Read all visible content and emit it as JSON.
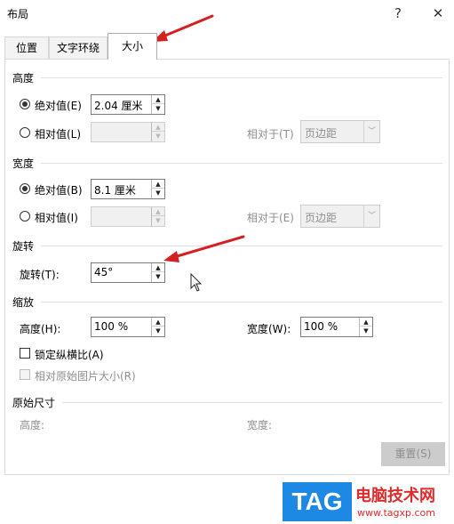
{
  "window": {
    "title": "布局",
    "help_icon": "?",
    "close_icon": "✕"
  },
  "tabs": [
    {
      "label": "位置",
      "active": false
    },
    {
      "label": "文字环绕",
      "active": false
    },
    {
      "label": "大小",
      "active": true
    }
  ],
  "height": {
    "section": "高度",
    "absolute_label": "绝对值(E)",
    "absolute_value": "2.04 厘米",
    "relative_label": "相对值(L)",
    "relative_value": "",
    "relative_to_label": "相对于(T)",
    "relative_to_value": "页边距"
  },
  "width": {
    "section": "宽度",
    "absolute_label": "绝对值(B)",
    "absolute_value": "8.1 厘米",
    "relative_label": "相对值(I)",
    "relative_value": "",
    "relative_to_label": "相对于(E)",
    "relative_to_value": "页边距"
  },
  "rotation": {
    "section": "旋转",
    "label": "旋转(T):",
    "value": "45°"
  },
  "scale": {
    "section": "缩放",
    "height_label": "高度(H):",
    "height_value": "100 %",
    "width_label": "宽度(W):",
    "width_value": "100 %",
    "lock_aspect_label": "锁定纵横比(A)",
    "lock_aspect_checked": false,
    "relative_original_label": "相对原始图片大小(R)",
    "relative_original_checked": false
  },
  "original_size": {
    "section": "原始尺寸",
    "height_label": "高度:",
    "width_label": "宽度:",
    "reset_label": "重置(S)"
  },
  "watermark": {
    "logo": "TAG",
    "site_name": "电脑技术网",
    "url": "www.tagxp.com"
  },
  "colors": {
    "annotation_arrow": "#d42020",
    "watermark_blue": "#1e88e5",
    "watermark_red": "#e12b2b"
  }
}
